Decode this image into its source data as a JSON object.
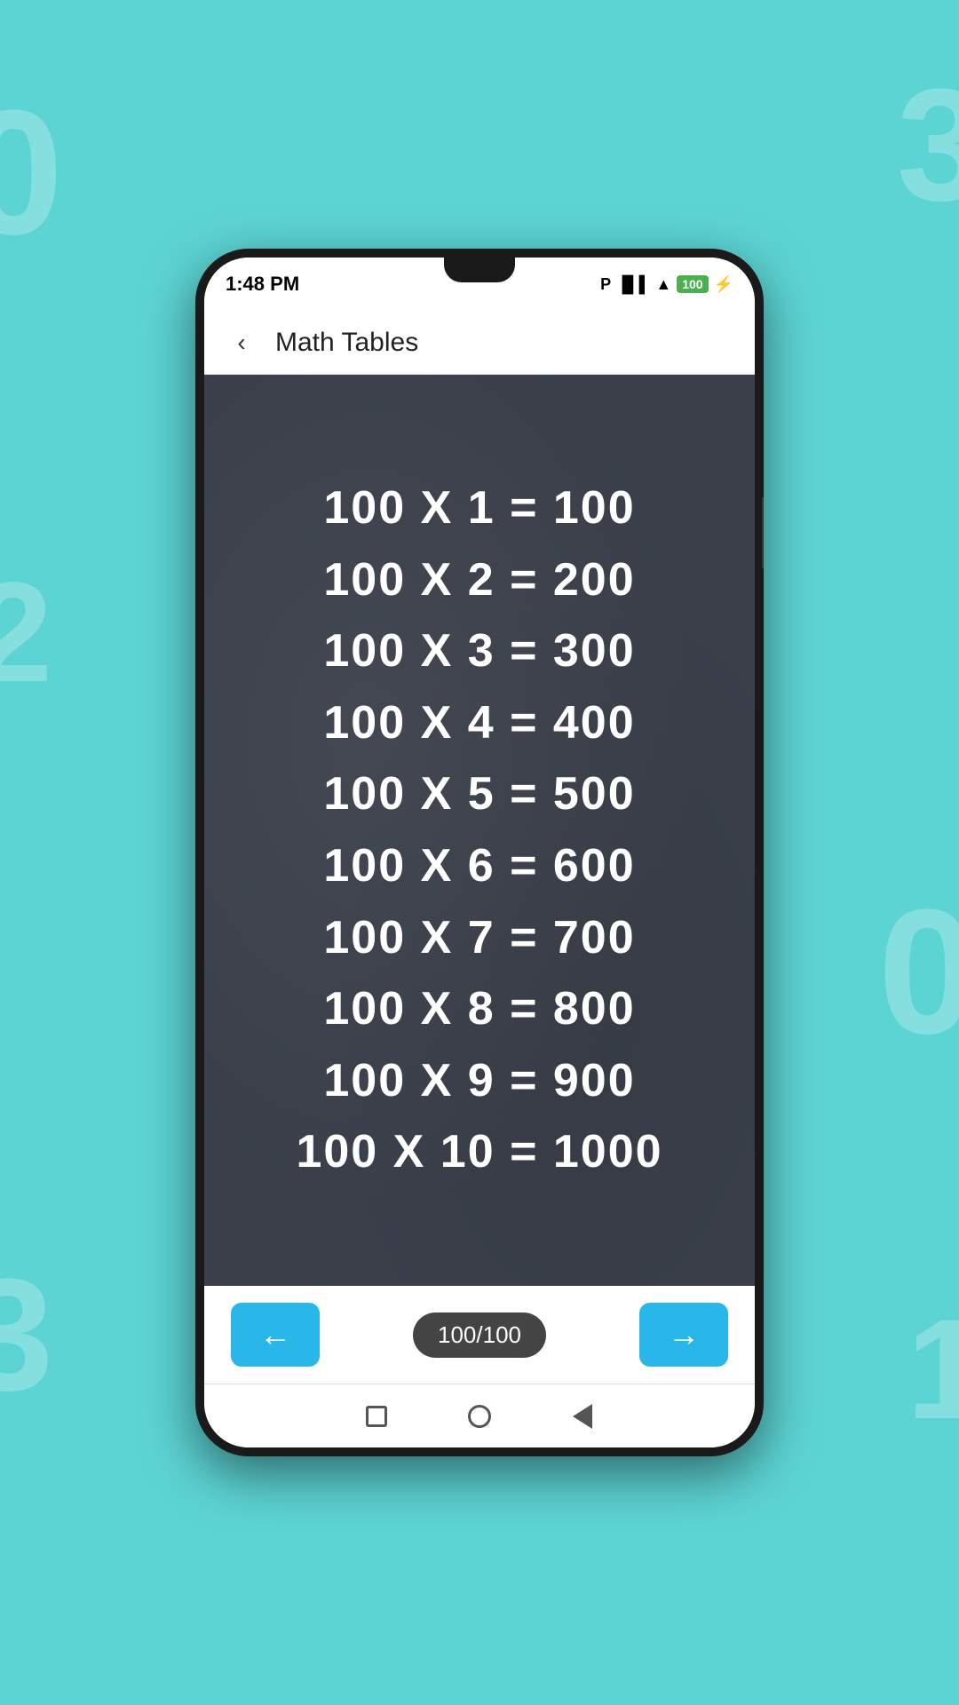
{
  "app": {
    "title": "Math Tables",
    "back_label": "‹"
  },
  "status_bar": {
    "time": "1:48 PM",
    "signal_icon": "P",
    "battery": "100"
  },
  "table": {
    "number": 100,
    "rows": [
      {
        "multiplier": 1,
        "result": 100
      },
      {
        "multiplier": 2,
        "result": 200
      },
      {
        "multiplier": 3,
        "result": 300
      },
      {
        "multiplier": 4,
        "result": 400
      },
      {
        "multiplier": 5,
        "result": 500
      },
      {
        "multiplier": 6,
        "result": 600
      },
      {
        "multiplier": 7,
        "result": 700
      },
      {
        "multiplier": 8,
        "result": 800
      },
      {
        "multiplier": 9,
        "result": 900
      },
      {
        "multiplier": 10,
        "result": 1000
      }
    ]
  },
  "navigation": {
    "prev_label": "←",
    "next_label": "→",
    "page_current": 100,
    "page_total": 100,
    "page_display": "100/100"
  },
  "colors": {
    "accent": "#29b6e8",
    "chalkboard": "#3a3f4a",
    "text_white": "#ffffff"
  }
}
